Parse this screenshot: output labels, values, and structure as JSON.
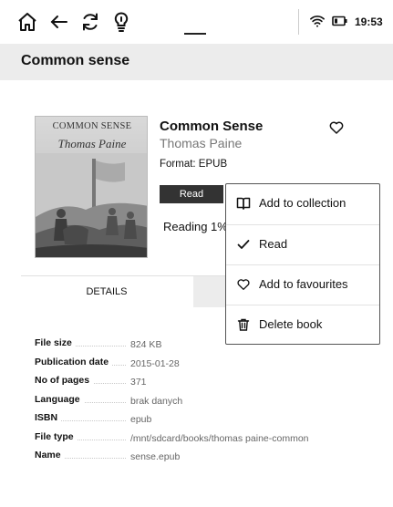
{
  "status_bar": {
    "time": "19:53",
    "icons": [
      "home-icon",
      "back-arrow-icon",
      "refresh-icon",
      "lightbulb-icon",
      "wifi-icon",
      "battery-icon"
    ]
  },
  "header": {
    "title": "Common sense"
  },
  "book": {
    "title": "Common Sense",
    "author": "Thomas Paine",
    "format": "Format: EPUB",
    "read_button": "Read",
    "reading_status": "Reading  1%",
    "cover": {
      "title": "COMMON SENSE",
      "author": "Thomas Paine"
    }
  },
  "tabs": [
    {
      "label": "DETAILS"
    }
  ],
  "details": [
    {
      "label": "File size",
      "value": "824 KB"
    },
    {
      "label": "Publication date",
      "value": "2015-01-28"
    },
    {
      "label": "No of pages",
      "value": "371"
    },
    {
      "label": "Language",
      "value": "brak danych"
    },
    {
      "label": "ISBN",
      "value": "epub"
    },
    {
      "label": "File type",
      "value": "/mnt/sdcard/books/thomas paine-common"
    },
    {
      "label": "Name",
      "value": "sense.epub"
    }
  ],
  "menu": {
    "items": [
      {
        "label": "Add to collection",
        "icon": "book-icon"
      },
      {
        "label": "Read",
        "icon": "checkmark-icon"
      },
      {
        "label": "Add to favourites",
        "icon": "heart-icon"
      },
      {
        "label": "Delete book",
        "icon": "trash-icon"
      }
    ]
  },
  "colors": {
    "title_bar": "#ececec",
    "read_button": "#333333",
    "menu_border": "#555555"
  }
}
